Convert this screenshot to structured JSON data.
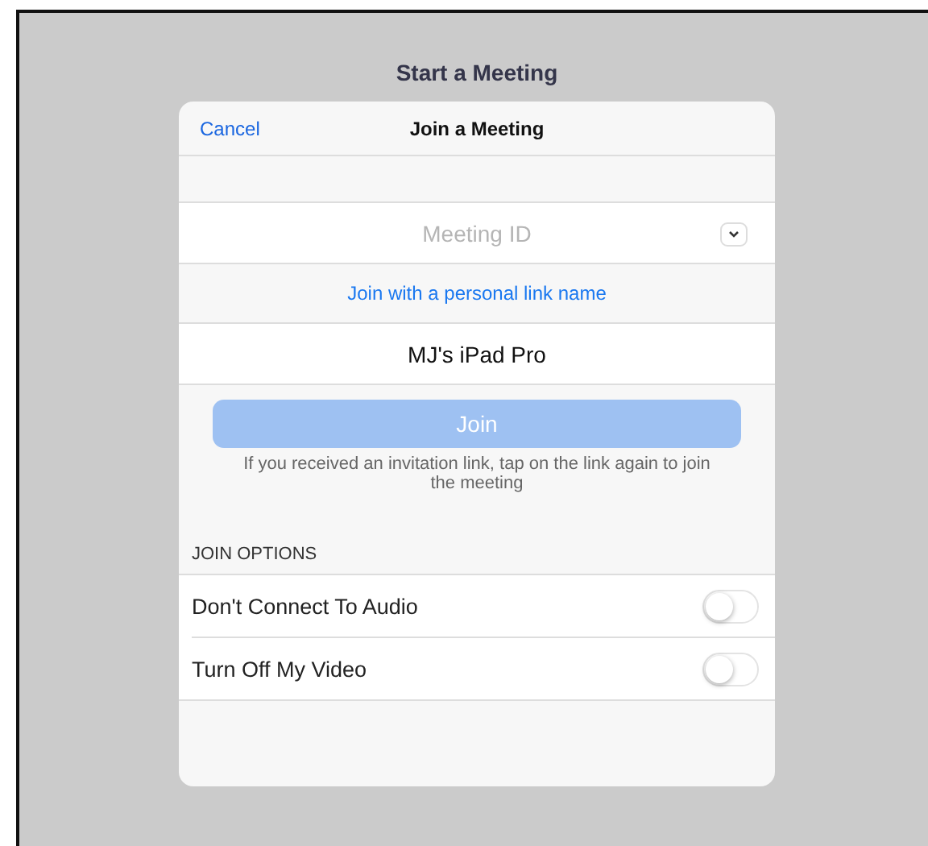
{
  "background": {
    "title": "Start a Meeting"
  },
  "dialog": {
    "cancel": "Cancel",
    "title": "Join a Meeting",
    "meeting_id": {
      "placeholder": "Meeting ID"
    },
    "personal_link": "Join with a personal link name",
    "name_field": {
      "value": "MJ's iPad Pro"
    },
    "join_button": {
      "label": "Join",
      "disabled": true
    },
    "hint": "If you received an invitation link, tap on the link again to join the meeting",
    "options_header": "JOIN OPTIONS",
    "options": [
      {
        "label": "Don't Connect To Audio",
        "on": false
      },
      {
        "label": "Turn Off My Video",
        "on": false
      }
    ]
  }
}
